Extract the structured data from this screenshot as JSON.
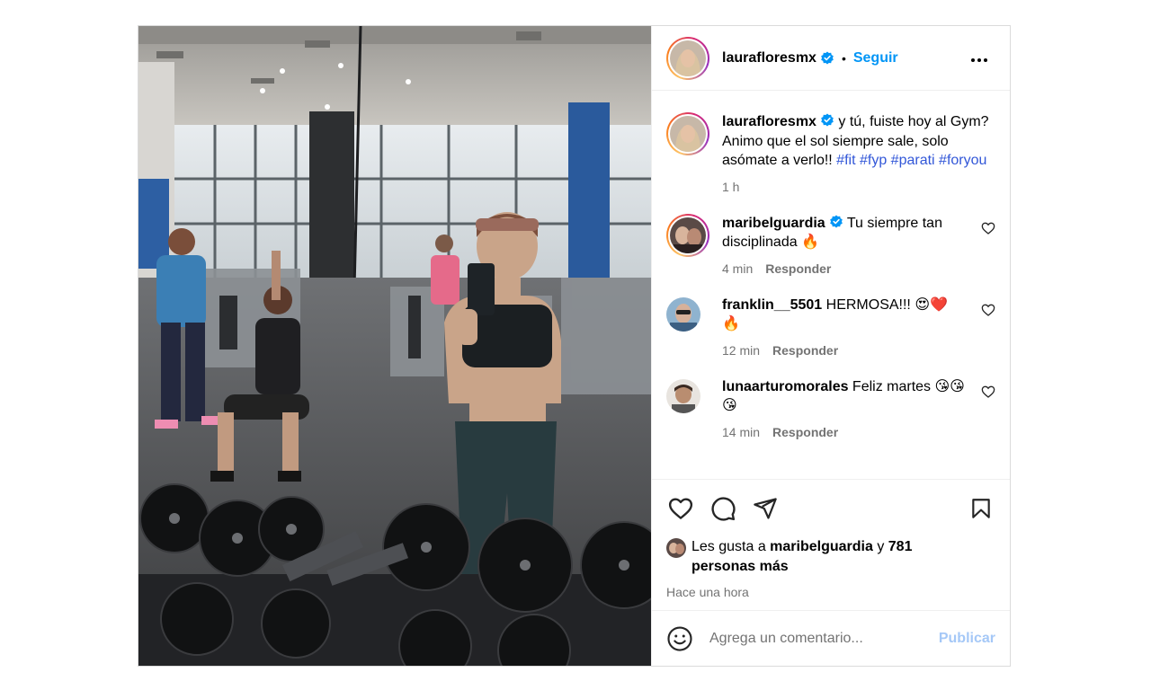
{
  "post": {
    "author": "laurafloresmx",
    "follow_label": "Seguir",
    "dot": "•",
    "more_label": "•••",
    "photo_alt": "",
    "caption": {
      "user": "laurafloresmx",
      "text": " y tú, fuiste hoy al Gym? Animo que el sol siempre sale, solo asómate a verlo!! ",
      "hashtags": [
        "#fit",
        "#fyp",
        "#parati",
        "#foryou"
      ],
      "time": "1 h"
    },
    "comments": [
      {
        "user": "maribelguardia",
        "verified": true,
        "text": " Tu siempre tan disciplinada 🔥",
        "time": "4 min",
        "reply": "Responder"
      },
      {
        "user": "franklin__5501",
        "verified": false,
        "text": " HERMOSA!!! 😍❤️🔥",
        "time": "12 min",
        "reply": "Responder"
      },
      {
        "user": "lunaarturomorales",
        "verified": false,
        "text": " Feliz martes 😘😘😘",
        "time": "14 min",
        "reply": "Responder"
      }
    ],
    "likes": {
      "prefix": "Les gusta a ",
      "user": "maribelguardia",
      "middle": " y ",
      "count": "781",
      "suffix": "personas más"
    },
    "timestamp": "Hace una hora",
    "composer": {
      "placeholder": "Agrega un comentario...",
      "publish": "Publicar"
    },
    "colors": {
      "accent": "#0095f6",
      "verified": "#0095f6",
      "hashtag": "#3257d8",
      "muted": "#737373",
      "publish_disabled": "#a5c8f7"
    },
    "icons": [
      "verified-icon",
      "more-icon",
      "heart-icon",
      "comment-icon",
      "share-icon",
      "bookmark-icon",
      "emoji-icon"
    ]
  }
}
